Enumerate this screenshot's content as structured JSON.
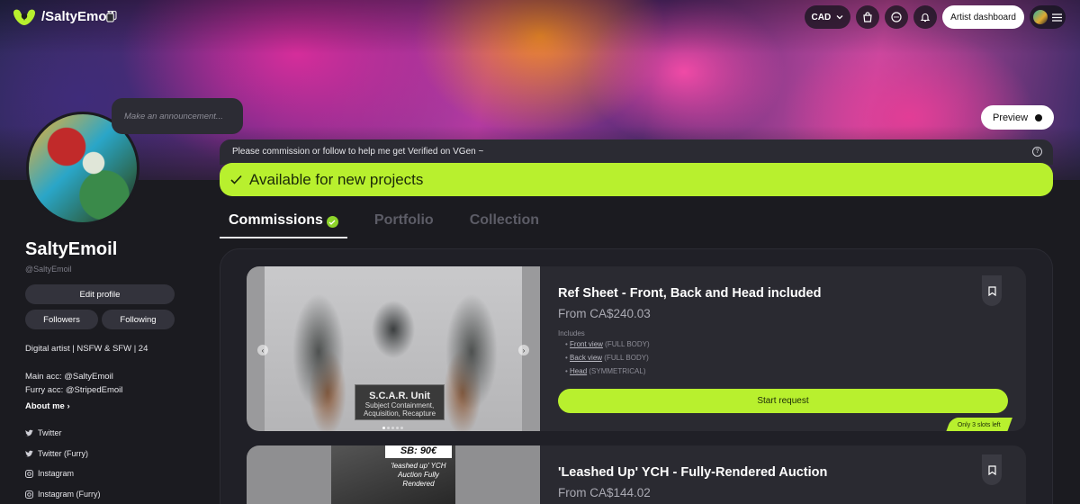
{
  "nav": {
    "handle": "/SaltyEmoil",
    "currency": "CAD",
    "dashboard_label": "Artist dashboard"
  },
  "banner": {
    "preview_label": "Preview",
    "announcement_placeholder": "Make an announcement..."
  },
  "profile": {
    "name": "SaltyEmoil",
    "handle": "@SaltyEmoil",
    "edit_label": "Edit profile",
    "followers_label": "Followers",
    "following_label": "Following",
    "bio_line1": "Digital artist | NSFW & SFW | 24",
    "bio_line2": "Main acc: @SaltyEmoil",
    "bio_line3": "Furry acc: @StripedEmoil",
    "about_label": "About me",
    "socials": [
      "Twitter",
      "Twitter (Furry)",
      "Instagram",
      "Instagram (Furry)"
    ]
  },
  "notice": {
    "text": "Please commission or follow to help me get Verified on VGen ~",
    "available": "Available for new projects"
  },
  "tabs": [
    "Commissions",
    "Portfolio",
    "Collection"
  ],
  "commissions": [
    {
      "title": "Ref Sheet - Front, Back and Head included",
      "price": "From CA$240.03",
      "includes_label": "Includes",
      "includes": [
        {
          "name": "Front view",
          "note": "(FULL BODY)"
        },
        {
          "name": "Back view",
          "note": "(FULL BODY)"
        },
        {
          "name": "Head",
          "note": "(SYMMETRICAL)"
        }
      ],
      "start_label": "Start request",
      "slots": "Only 3 slots left",
      "image_caption_title": "S.C.A.R. Unit",
      "image_caption_sub": "Subject Containment, Acquisition, Recapture"
    },
    {
      "title": "'Leashed Up' YCH - Fully-Rendered Auction",
      "price": "From CA$144.02",
      "image_price": "SB: 90€",
      "image_sub": "'leashed up' YCH Auction Fully Rendered"
    }
  ],
  "colors": {
    "accent": "#b8f02e",
    "background": "#1b1b20",
    "card": "#2a2a31"
  }
}
